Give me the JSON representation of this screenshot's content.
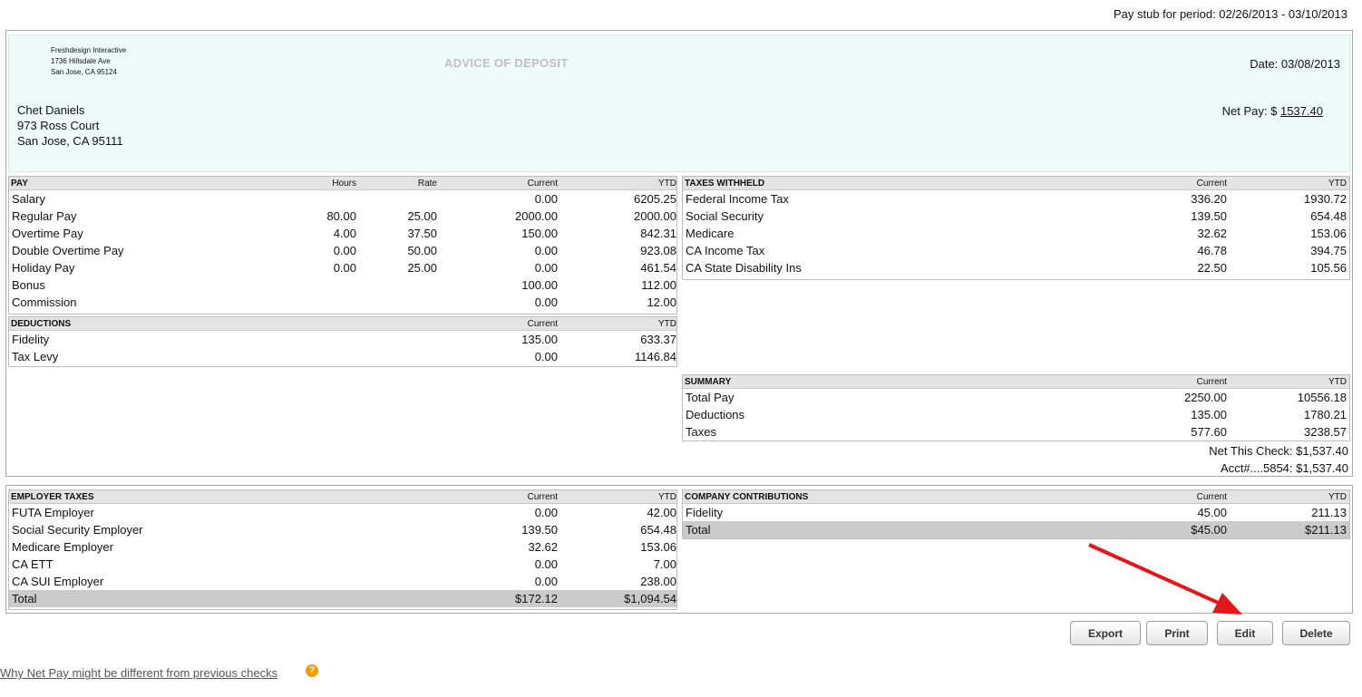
{
  "period_label": "Pay stub for period: 02/26/2013 - 03/10/2013",
  "company": {
    "name": "Freshdesign Interactive",
    "address1": "1736 Hillsdale Ave",
    "address2": "San Jose, CA 95124"
  },
  "advice_title": "ADVICE OF DEPOSIT",
  "date": {
    "label": "Date:",
    "value": "03/08/2013"
  },
  "employee": {
    "name": "Chet Daniels",
    "address1": "973 Ross Court",
    "address2": "San Jose, CA 95111"
  },
  "net_pay": {
    "label": "Net Pay: $",
    "value": "1537.40"
  },
  "pay": {
    "headers": [
      "PAY",
      "Hours",
      "Rate",
      "Current",
      "YTD"
    ],
    "rows": [
      [
        "Salary",
        "",
        "",
        "0.00",
        "6205.25"
      ],
      [
        "Regular Pay",
        "80.00",
        "25.00",
        "2000.00",
        "2000.00"
      ],
      [
        "Overtime Pay",
        "4.00",
        "37.50",
        "150.00",
        "842.31"
      ],
      [
        "Double Overtime Pay",
        "0.00",
        "50.00",
        "0.00",
        "923.08"
      ],
      [
        "Holiday Pay",
        "0.00",
        "25.00",
        "0.00",
        "461.54"
      ],
      [
        "Bonus",
        "",
        "",
        "100.00",
        "112.00"
      ],
      [
        "Commission",
        "",
        "",
        "0.00",
        "12.00"
      ]
    ]
  },
  "deductions": {
    "headers": [
      "DEDUCTIONS",
      "Current",
      "YTD"
    ],
    "rows": [
      [
        "Fidelity",
        "135.00",
        "633.37"
      ],
      [
        "Tax Levy",
        "0.00",
        "1146.84"
      ]
    ]
  },
  "taxes": {
    "headers": [
      "TAXES WITHHELD",
      "Current",
      "YTD"
    ],
    "rows": [
      [
        "Federal Income Tax",
        "336.20",
        "1930.72"
      ],
      [
        "Social Security",
        "139.50",
        "654.48"
      ],
      [
        "Medicare",
        "32.62",
        "153.06"
      ],
      [
        "CA Income Tax",
        "46.78",
        "394.75"
      ],
      [
        "CA State Disability Ins",
        "22.50",
        "105.56"
      ]
    ]
  },
  "summary": {
    "headers": [
      "SUMMARY",
      "Current",
      "YTD"
    ],
    "rows": [
      [
        "Total Pay",
        "2250.00",
        "10556.18"
      ],
      [
        "Deductions",
        "135.00",
        "1780.21"
      ],
      [
        "Taxes",
        "577.60",
        "3238.57"
      ]
    ],
    "net_check_label": "Net This Check:",
    "net_check_value": "$1,537.40",
    "acct_label": "Acct#....5854:",
    "acct_value": "$1,537.40"
  },
  "employer_taxes": {
    "headers": [
      "EMPLOYER TAXES",
      "Current",
      "YTD"
    ],
    "rows": [
      [
        "FUTA Employer",
        "0.00",
        "42.00"
      ],
      [
        "Social Security Employer",
        "139.50",
        "654.48"
      ],
      [
        "Medicare Employer",
        "32.62",
        "153.06"
      ],
      [
        "CA ETT",
        "0.00",
        "7.00"
      ],
      [
        "CA SUI Employer",
        "0.00",
        "238.00"
      ]
    ],
    "total": [
      "Total",
      "$172.12",
      "$1,094.54"
    ]
  },
  "company_contributions": {
    "headers": [
      "COMPANY CONTRIBUTIONS",
      "Current",
      "YTD"
    ],
    "rows": [
      [
        "Fidelity",
        "45.00",
        "211.13"
      ]
    ],
    "total": [
      "Total",
      "$45.00",
      "$211.13"
    ]
  },
  "buttons": {
    "export": "Export",
    "print": "Print",
    "edit": "Edit",
    "delete": "Delete"
  },
  "help_link": "Why Net Pay might be different from previous checks",
  "help_icon_glyph": "?",
  "annotation_arrow_color": "#e8141b"
}
